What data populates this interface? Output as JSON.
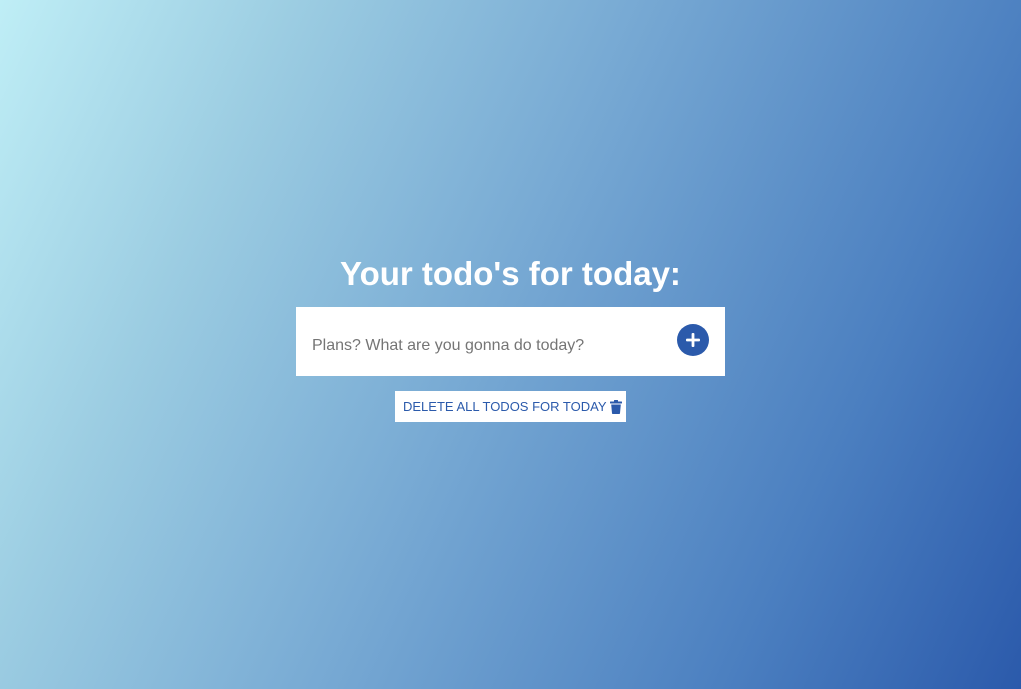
{
  "header": {
    "title": "Your todo's for today:"
  },
  "todo_form": {
    "input_value": "",
    "input_placeholder": "Plans? What are you gonna do today?",
    "add_icon": "plus-icon"
  },
  "actions": {
    "delete_all_label": "DELETE ALL TODOS FOR TODAY",
    "delete_icon": "trash-icon"
  },
  "colors": {
    "accent": "#2b5aab",
    "gradient_start": "#bfeef6",
    "gradient_end": "#2b5aab",
    "surface": "#ffffff"
  }
}
